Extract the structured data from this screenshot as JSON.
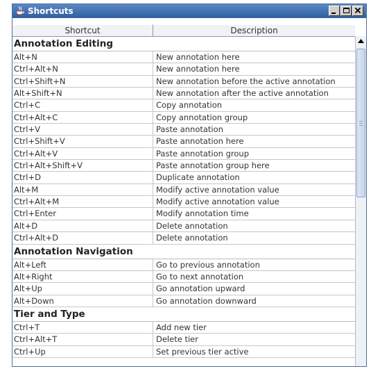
{
  "window": {
    "title": "Shortcuts",
    "minimize_label": "_",
    "maximize_label": "□",
    "close_label": "X"
  },
  "columns": {
    "shortcut": "Shortcut",
    "description": "Description"
  },
  "groups": [
    {
      "name": "Annotation Editing",
      "rows": [
        {
          "shortcut": "Alt+N",
          "description": "New annotation here"
        },
        {
          "shortcut": "Ctrl+Alt+N",
          "description": "New annotation here"
        },
        {
          "shortcut": "Ctrl+Shift+N",
          "description": "New annotation before the active annotation"
        },
        {
          "shortcut": "Alt+Shift+N",
          "description": "New annotation after the active annotation"
        },
        {
          "shortcut": "Ctrl+C",
          "description": "Copy annotation"
        },
        {
          "shortcut": "Ctrl+Alt+C",
          "description": "Copy annotation group"
        },
        {
          "shortcut": "Ctrl+V",
          "description": "Paste annotation"
        },
        {
          "shortcut": "Ctrl+Shift+V",
          "description": "Paste annotation here"
        },
        {
          "shortcut": "Ctrl+Alt+V",
          "description": "Paste annotation group"
        },
        {
          "shortcut": "Ctrl+Alt+Shift+V",
          "description": "Paste annotation group here"
        },
        {
          "shortcut": "Ctrl+D",
          "description": "Duplicate annotation"
        },
        {
          "shortcut": "Alt+M",
          "description": "Modify active annotation value"
        },
        {
          "shortcut": "Ctrl+Alt+M",
          "description": "Modify active annotation value"
        },
        {
          "shortcut": "Ctrl+Enter",
          "description": "Modify annotation time"
        },
        {
          "shortcut": "Alt+D",
          "description": "Delete annotation"
        },
        {
          "shortcut": "Ctrl+Alt+D",
          "description": "Delete annotation"
        }
      ]
    },
    {
      "name": "Annotation Navigation",
      "rows": [
        {
          "shortcut": "Alt+Left",
          "description": "Go to previous annotation"
        },
        {
          "shortcut": "Alt+Right",
          "description": "Go to next annotation"
        },
        {
          "shortcut": "Alt+Up",
          "description": "Go annotation upward"
        },
        {
          "shortcut": "Alt+Down",
          "description": "Go annotation downward"
        }
      ]
    },
    {
      "name": "Tier and Type",
      "rows": [
        {
          "shortcut": "Ctrl+T",
          "description": "Add new tier"
        },
        {
          "shortcut": "Ctrl+Alt+T",
          "description": "Delete tier"
        },
        {
          "shortcut": "Ctrl+Up",
          "description": "Set previous tier active"
        }
      ]
    }
  ],
  "colors": {
    "titlebar_top": "#5b88c6",
    "titlebar_bottom": "#2f5f9e",
    "grid_line": "#c4c7cc",
    "scroll_thumb": "#c8d6ec"
  }
}
